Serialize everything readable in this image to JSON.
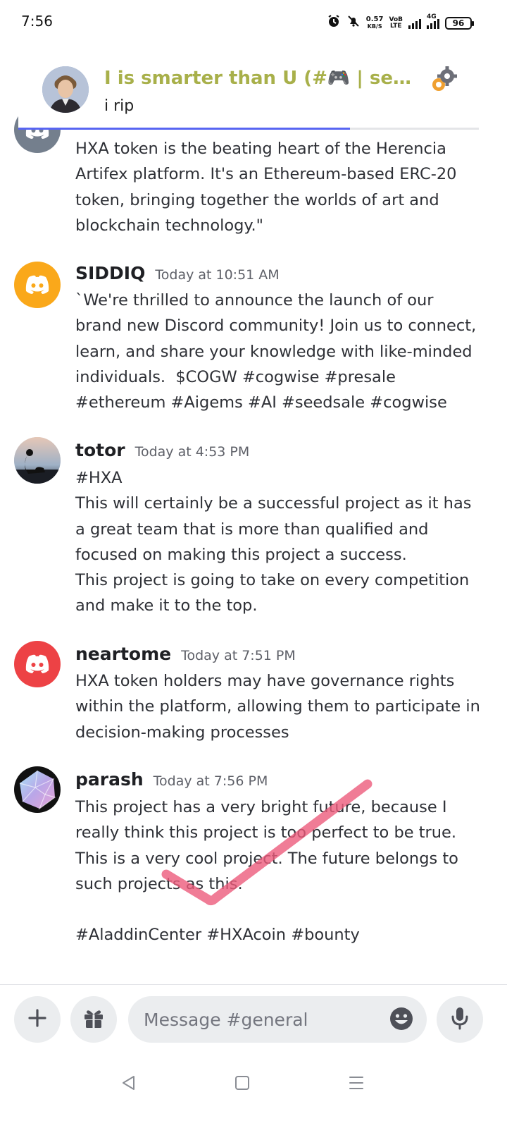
{
  "status_bar": {
    "time": "7:56",
    "net_speed_value": "0.57",
    "net_speed_unit": "KB/S",
    "volte_top": "VoB",
    "volte_bottom": "LTE",
    "network_type": "4G",
    "battery": "96"
  },
  "notification": {
    "title": "I is smarter than U (#🎮 | seaso...",
    "body": "i rip",
    "progress": 0.72,
    "accent": "#5865f2"
  },
  "messages": [
    {
      "username": "",
      "timestamp": "",
      "avatar_icon": "discord-icon",
      "avatar_color": "#747f8d",
      "text": "HXA token is the beating heart of the Herencia Artifex platform. It's an Ethereum-based ERC-20 token, bringing together the worlds of art and blockchain technology.\""
    },
    {
      "username": "SIDDIQ",
      "timestamp": "Today at 10:51 AM",
      "avatar_icon": "discord-icon",
      "avatar_color": "#faa81a",
      "text": "`We're thrilled to announce the launch of our brand new Discord community! Join us to connect, learn, and share your knowledge with like-minded individuals.  $COGW #cogwise #presale #ethereum #Aigems #AI #seedsale #cogwise"
    },
    {
      "username": "totor",
      "timestamp": "Today at 4:53 PM",
      "avatar_icon": "silhouette-photo",
      "text": "#HXA\nThis will certainly be a successful project as it has a great team that is more than qualified and focused on making this project a success.\nThis project is going to take on every competition and make it to the top."
    },
    {
      "username": "neartome",
      "timestamp": "Today at 7:51 PM",
      "avatar_icon": "discord-icon",
      "avatar_color": "#ed4245",
      "text": "HXA token holders may have governance rights within the platform, allowing them to participate in decision-making processes"
    },
    {
      "username": "parash",
      "timestamp": "Today at 7:56 PM",
      "avatar_icon": "gem-icon",
      "text": "This project has a very bright future, because I really think this project is too perfect to be true. This is a very cool project. The future belongs to such projects as this.\n\n#AladdinCenter #HXAcoin #bounty"
    }
  ],
  "composer": {
    "placeholder": "Message #general",
    "add_icon": "plus-icon",
    "gift_icon": "gift-icon",
    "emoji_icon": "emoji-icon",
    "mic_icon": "microphone-icon"
  },
  "nav": {
    "back_icon": "back-triangle-icon",
    "home_icon": "home-square-icon",
    "menu_icon": "menu-lines-icon"
  },
  "colors": {
    "checkmark": "#ec5b7c"
  }
}
